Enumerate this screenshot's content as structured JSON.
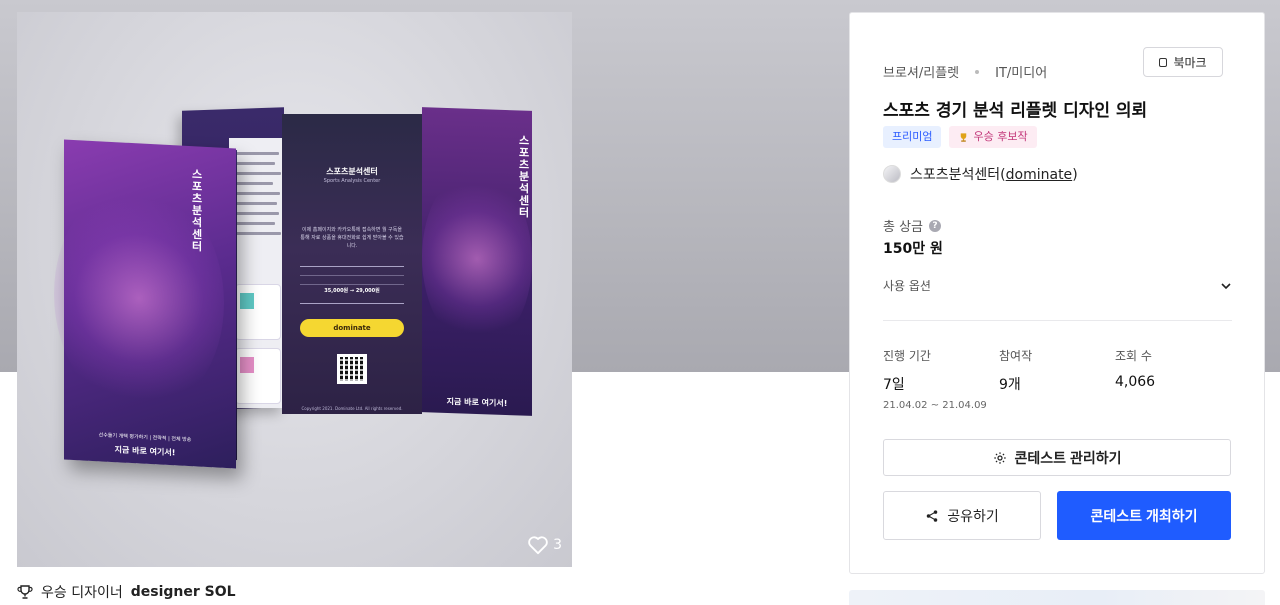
{
  "gallery": {
    "likes": "3",
    "brochure": {
      "cover_title": "스포츠분석센터",
      "cover_footer_1": "선수들기 개택 평가하기 | 전략적 | 전체 방송",
      "cover_footer_2": "지금 바로 여기서!",
      "center_title": "스포츠분석센터",
      "center_subtitle": "Sports Analysis Center",
      "center_body": "이제 홈페이지와 카카오톡에 접속하면 월 구독을 통해 자료 상품을 휴대전화로 쉽게 받아볼 수 있습니다.",
      "price": "35,000원 → 29,000원",
      "kakao_text": "dominate",
      "copyright": "Copyright 2021. Dominate Ltd. All rights reserved.",
      "right_title": "스포츠분석센터",
      "right_footer": "지금 바로 여기서!"
    }
  },
  "award": {
    "label": "우승 디자이너",
    "name": "designer SOL"
  },
  "card": {
    "category_1": "브로셔/리플렛",
    "category_2": "IT/미디어",
    "bookmark_label": "북마크",
    "title": "스포츠 경기 분석 리플렛 디자인 의뢰",
    "badge_premium": "프리미엄",
    "badge_award": "우승 후보작",
    "owner_name": "스포츠분석센터",
    "owner_id": "dominate",
    "prize_label": "총 상금",
    "prize_value": "150만 원",
    "use_option": "사용 옵션",
    "stats": {
      "period_label": "진행 기간",
      "period_value": "7일",
      "period_range": "21.04.02 ~ 21.04.09",
      "participants_label": "참여작",
      "participants_value": "9개",
      "views_label": "조회 수",
      "views_value": "4,066"
    },
    "manage_button": "콘테스트 관리하기",
    "share_button": "공유하기",
    "host_button": "콘테스트 개최하기"
  },
  "colors": {
    "primary": "#1f5cff",
    "premium_badge_bg": "#e8f0ff",
    "award_badge_bg": "#fdecf3"
  }
}
